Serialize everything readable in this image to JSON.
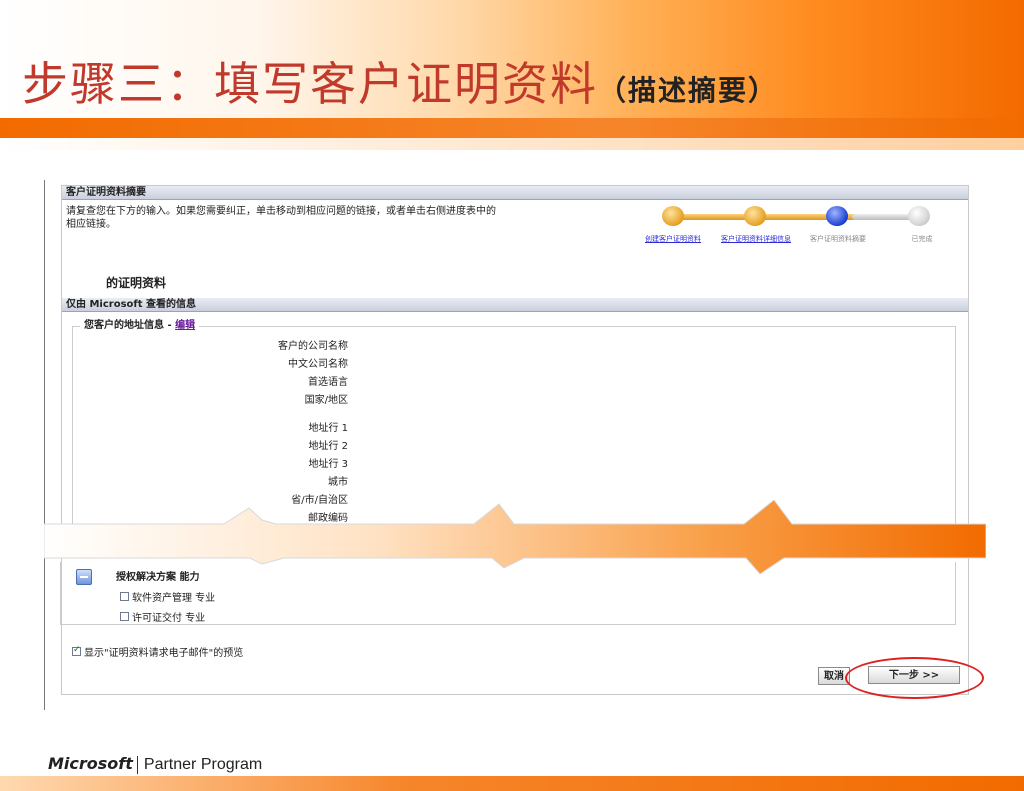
{
  "slide": {
    "title": "步骤三：填写客户证明资料",
    "subtitle": "（描述摘要）"
  },
  "panel": {
    "header": "客户证明资料摘要",
    "intro": "请复查您在下方的输入。如果您需要纠正，单击移动到相应问题的链接，或者单击右侧进度表中的相应链接。",
    "cert_title": "的证明资料",
    "section_bar": "仅由 Microsoft 查看的信息",
    "address_legend": "您客户的地址信息",
    "address_legend_sep": "-",
    "edit_link": "编辑",
    "address_fields": [
      "客户的公司名称",
      "中文公司名称",
      "首选语言",
      "国家/地区",
      "地址行 1",
      "地址行 2",
      "地址行 3",
      "城市",
      "省/市/自治区",
      "邮政编码"
    ]
  },
  "progress": {
    "steps": [
      {
        "label": "创建客户证明资料",
        "state": "done",
        "link": true
      },
      {
        "label": "客户证明资料详细信息",
        "state": "done",
        "link": true
      },
      {
        "label": "客户证明资料摘要",
        "state": "current",
        "link": false
      },
      {
        "label": "已完成",
        "state": "todo",
        "link": false
      }
    ]
  },
  "solutions": {
    "title": "授权解决方案 能力",
    "items": [
      {
        "label": "软件资产管理 专业",
        "checked": false
      },
      {
        "label": "许可证交付 专业",
        "checked": false
      }
    ]
  },
  "preview": {
    "label": "显示\"证明资料请求电子邮件\"的预览",
    "checked": true
  },
  "buttons": {
    "cancel": "取消",
    "next": "下一步 >>"
  },
  "footer": {
    "brand": "Microsoft",
    "program": "Partner Program"
  },
  "colors": {
    "accent": "#f26b00",
    "title": "#c0392b",
    "link": "#2b2bd8",
    "highlight": "#d22222"
  }
}
